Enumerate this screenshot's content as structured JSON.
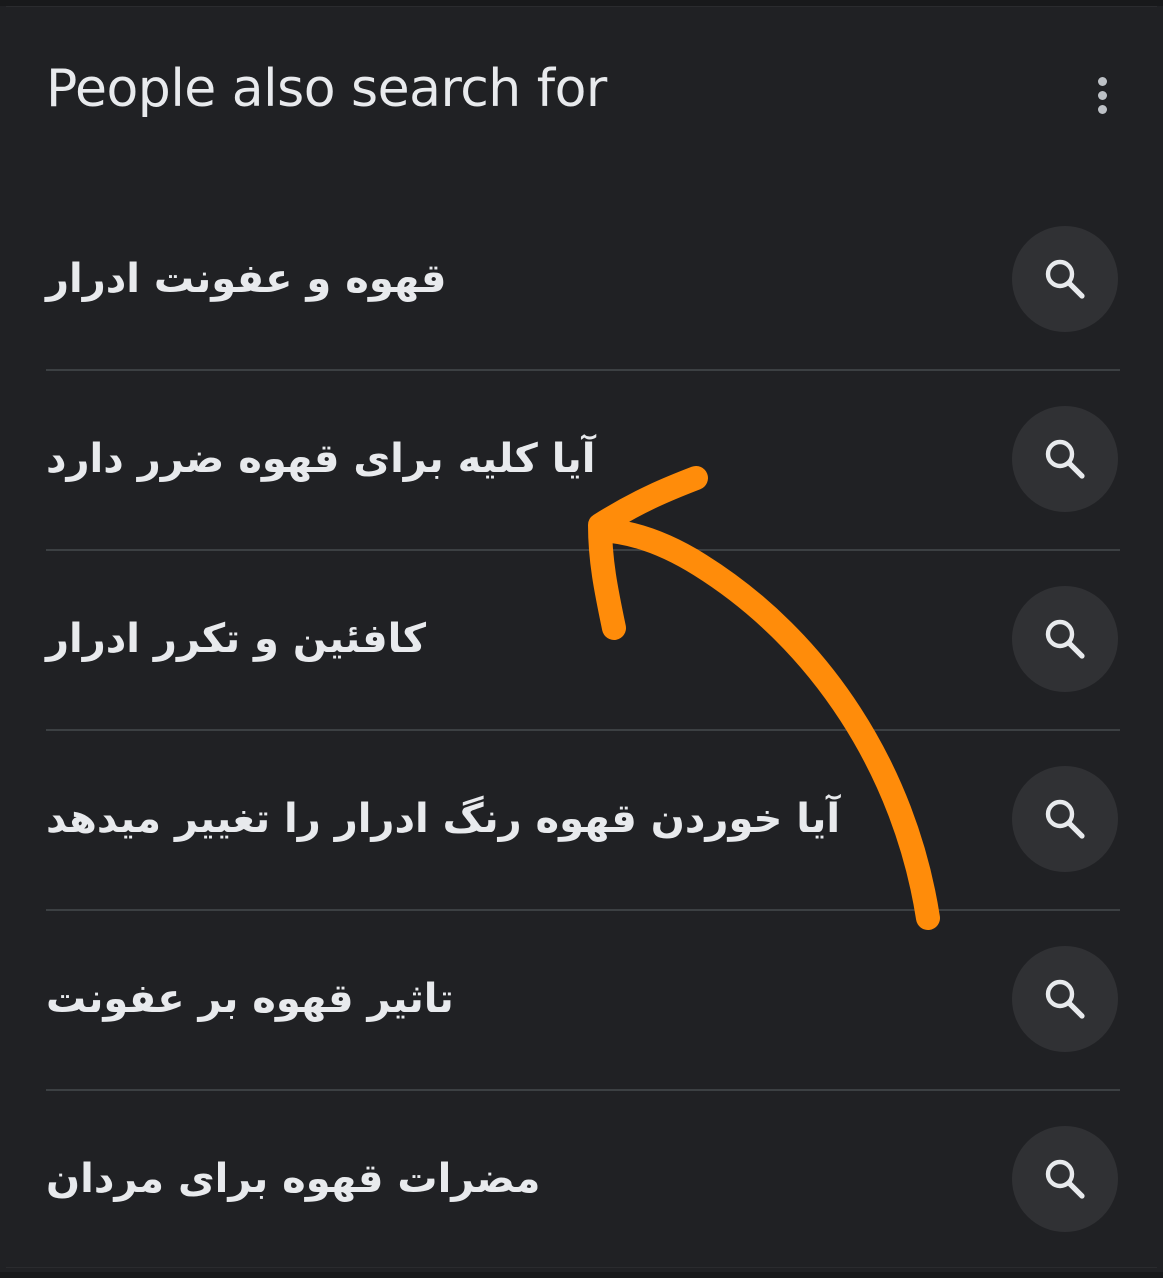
{
  "header": {
    "title": "People also search for",
    "more_icon": "more-vert-icon"
  },
  "items": [
    {
      "label": "قهوه و عفونت ادرار",
      "icon": "search-icon"
    },
    {
      "label": "آیا کلیه  برای قهوه ضرر دارد",
      "icon": "search-icon"
    },
    {
      "label": "کافئین و تکرر ادرار",
      "icon": "search-icon"
    },
    {
      "label": "آیا خوردن قهوه رنگ ادرار را تغییر میدهد",
      "icon": "search-icon"
    },
    {
      "label": "تاثیر قهوه بر عفونت",
      "icon": "search-icon"
    },
    {
      "label": "مضرات قهوه برای مردان",
      "icon": "search-icon"
    }
  ],
  "annotation": {
    "shape": "hand-drawn-arrow",
    "color": "#ff8c0a",
    "points_to_item": 2
  },
  "colors": {
    "background": "#202124",
    "text": "#e8eaed",
    "divider": "#3c4043",
    "button": "#303134",
    "icon": "#e8eaed"
  }
}
